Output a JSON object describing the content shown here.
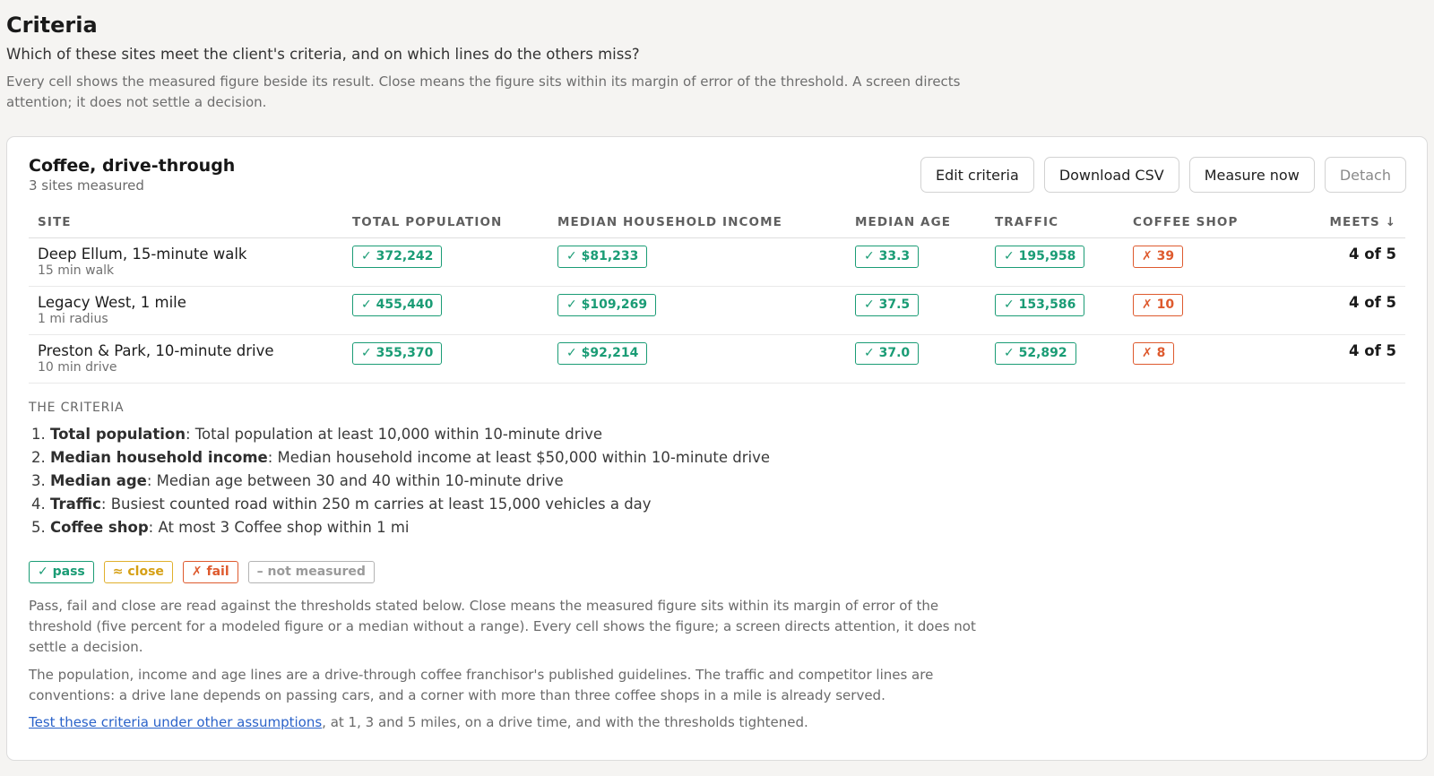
{
  "page": {
    "title": "Criteria",
    "question": "Which of these sites meet the client's criteria, and on which lines do the others miss?",
    "intro": "Every cell shows the measured figure beside its result. Close means the figure sits within its margin of error of the threshold. A screen directs attention; it does not settle a decision."
  },
  "card": {
    "title": "Coffee, drive-through",
    "subtitle": "3 sites measured",
    "buttons": {
      "edit": "Edit criteria",
      "download": "Download CSV",
      "measure": "Measure now",
      "detach": "Detach"
    }
  },
  "table": {
    "headers": {
      "site": "SITE",
      "population": "TOTAL POPULATION",
      "income": "MEDIAN HOUSEHOLD INCOME",
      "age": "MEDIAN AGE",
      "traffic": "TRAFFIC",
      "coffee": "COFFEE SHOP",
      "meets": "MEETS ↓"
    },
    "rows": [
      {
        "name": "Deep Ellum, 15-minute walk",
        "meta": "15 min walk",
        "population": "✓ 372,242",
        "income": "✓ $81,233",
        "age": "✓ 33.3",
        "traffic": "✓ 195,958",
        "coffee": "✗ 39",
        "meets": "4 of 5"
      },
      {
        "name": "Legacy West, 1 mile",
        "meta": "1 mi radius",
        "population": "✓ 455,440",
        "income": "✓ $109,269",
        "age": "✓ 37.5",
        "traffic": "✓ 153,586",
        "coffee": "✗ 10",
        "meets": "4 of 5"
      },
      {
        "name": "Preston & Park, 10-minute drive",
        "meta": "10 min drive",
        "population": "✓ 355,370",
        "income": "✓ $92,214",
        "age": "✓ 37.0",
        "traffic": "✓ 52,892",
        "coffee": "✗ 8",
        "meets": "4 of 5"
      }
    ]
  },
  "criteria": {
    "heading": "THE CRITERIA",
    "items": [
      {
        "name": "Total population",
        "text": ": Total population at least 10,000 within 10-minute drive"
      },
      {
        "name": "Median household income",
        "text": ": Median household income at least $50,000 within 10-minute drive"
      },
      {
        "name": "Median age",
        "text": ": Median age between 30 and 40 within 10-minute drive"
      },
      {
        "name": "Traffic",
        "text": ": Busiest counted road within 250 m carries at least 15,000 vehicles a day"
      },
      {
        "name": "Coffee shop",
        "text": ": At most 3 Coffee shop within 1 mi"
      }
    ]
  },
  "legend": {
    "pass": "✓ pass",
    "close": "≈ close",
    "fail": "✗ fail",
    "na": "– not measured"
  },
  "notes": {
    "thresholds": "Pass, fail and close are read against the thresholds stated below. Close means the measured figure sits within its margin of error of the threshold (five percent for a modeled figure or a median without a range). Every cell shows the figure; a screen directs attention, it does not settle a decision.",
    "sources": "The population, income and age lines are a drive-through coffee franchisor's published guidelines. The traffic and competitor lines are conventions: a drive lane depends on passing cars, and a corner with more than three coffee shops in a mile is already served.",
    "link": "Test these criteria under other assumptions",
    "link_rest": ", at 1, 3 and 5 miles, on a drive time, and with the thresholds tightened."
  },
  "colors": {
    "pass": "#1a9c75",
    "close": "#d6a015",
    "fail": "#de5a2e",
    "link": "#2a62c9"
  }
}
